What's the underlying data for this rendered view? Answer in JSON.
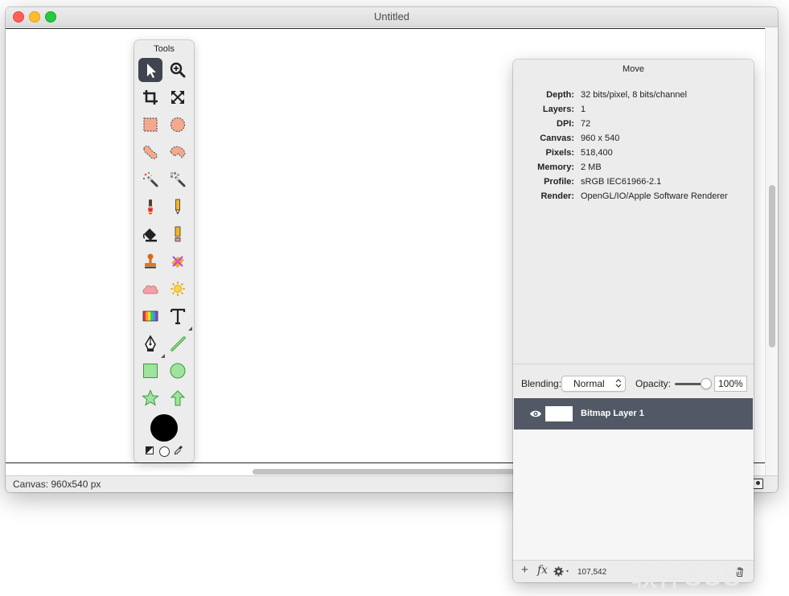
{
  "window": {
    "title": "Untitled",
    "status_text": "Canvas: 960x540 px"
  },
  "tools_panel": {
    "title": "Tools",
    "tools": [
      {
        "name": "move-tool-icon",
        "selected": true
      },
      {
        "name": "zoom-tool-icon"
      },
      {
        "name": "crop-tool-icon"
      },
      {
        "name": "scale-tool-icon"
      },
      {
        "name": "rect-select-icon"
      },
      {
        "name": "ellipse-select-icon"
      },
      {
        "name": "lasso-select-icon"
      },
      {
        "name": "polygon-lasso-icon"
      },
      {
        "name": "magic-wand-icon"
      },
      {
        "name": "color-select-icon"
      },
      {
        "name": "paint-brush-icon"
      },
      {
        "name": "pencil-icon"
      },
      {
        "name": "paint-bucket-icon"
      },
      {
        "name": "eraser-icon"
      },
      {
        "name": "clone-stamp-icon"
      },
      {
        "name": "smudge-icon"
      },
      {
        "name": "cloud-shape-icon"
      },
      {
        "name": "effects-icon"
      },
      {
        "name": "gradient-icon"
      },
      {
        "name": "text-tool-icon"
      },
      {
        "name": "pen-tool-icon"
      },
      {
        "name": "line-tool-icon"
      },
      {
        "name": "rectangle-shape-icon"
      },
      {
        "name": "ellipse-shape-icon"
      },
      {
        "name": "star-shape-icon"
      },
      {
        "name": "arrow-shape-icon"
      }
    ],
    "colors": {
      "foreground": "#000000",
      "background": "#ffffff"
    }
  },
  "inspector": {
    "title": "Move",
    "info": [
      {
        "label": "Depth:",
        "value": "32 bits/pixel, 8 bits/channel"
      },
      {
        "label": "Layers:",
        "value": "1"
      },
      {
        "label": "DPI:",
        "value": "72"
      },
      {
        "label": "Canvas:",
        "value": "960 x 540"
      },
      {
        "label": "Pixels:",
        "value": "518,400"
      },
      {
        "label": "Memory:",
        "value": "2 MB"
      },
      {
        "label": "Profile:",
        "value": "sRGB IEC61966-2.1"
      },
      {
        "label": "Render:",
        "value": "OpenGL/IO/Apple Software Renderer"
      }
    ],
    "blending_label": "Blending:",
    "blending_value": "Normal",
    "opacity_label": "Opacity:",
    "opacity_value": "100%",
    "opacity_level": 1.0,
    "layers": [
      {
        "name": "Bitmap Layer 1",
        "visible": true,
        "selected": true
      }
    ],
    "bottom": {
      "add_label": "+",
      "fx_label": "fx",
      "memory_count": "107,542"
    }
  },
  "watermark": "软件SOS"
}
